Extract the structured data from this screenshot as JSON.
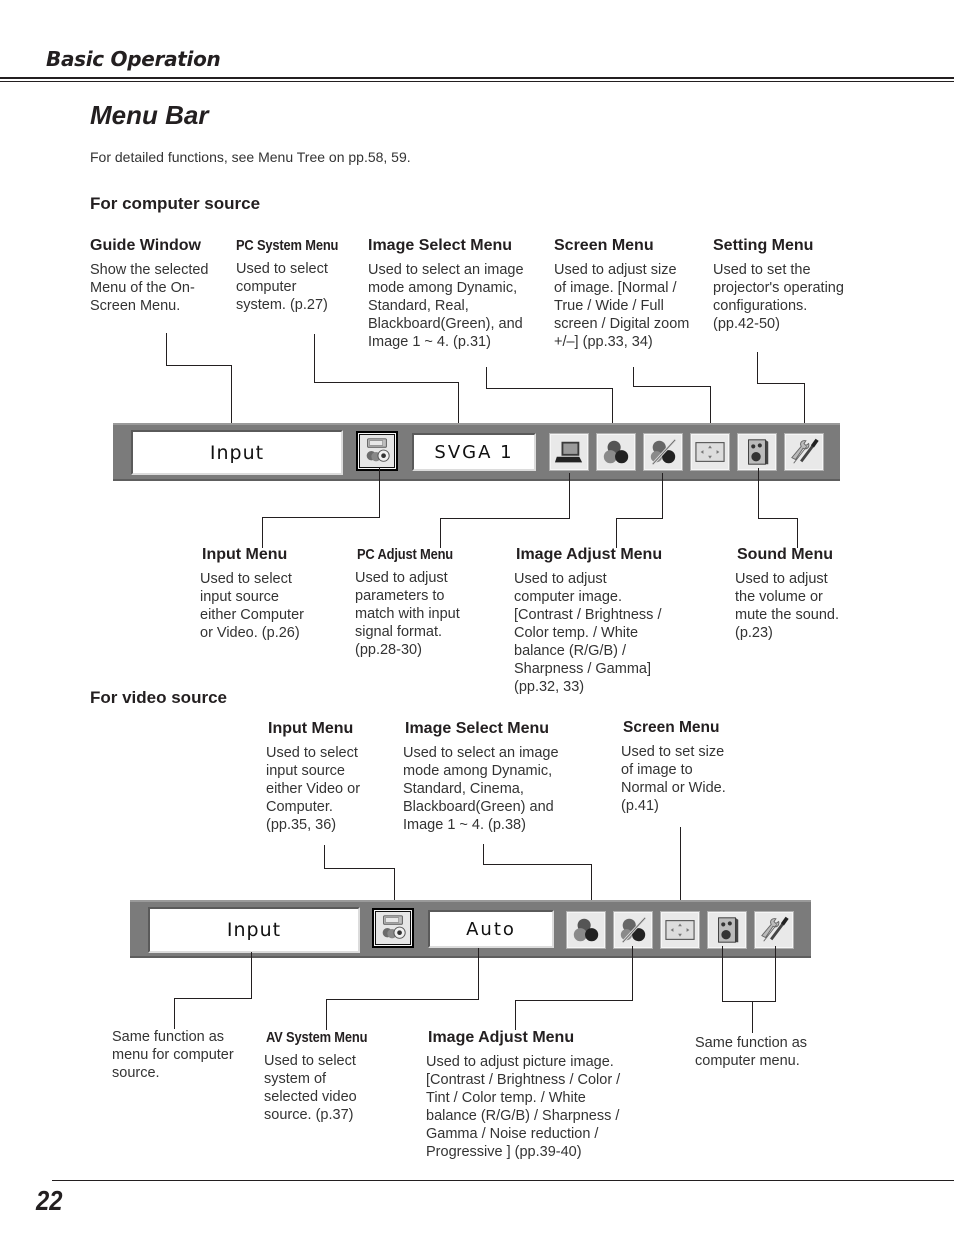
{
  "header": {
    "section": "Basic Operation"
  },
  "page": {
    "title": "Menu Bar",
    "intro": "For detailed functions, see Menu Tree on pp.58, 59.",
    "number": "22"
  },
  "computer_source": {
    "heading": "For computer source",
    "bar": {
      "guide_window_text": "Input",
      "system_text": "SVGA 1",
      "icons": [
        "input-menu-icon",
        "laptop-icon",
        "image-select-icon",
        "image-adjust-icon",
        "screen-icon",
        "sound-icon",
        "setting-icon"
      ]
    },
    "top_labels": [
      {
        "title": "Guide Window",
        "body": "Show the selected\nMenu of the On-\nScreen Menu."
      },
      {
        "title": "PC System Menu",
        "body": "Used to select\ncomputer\nsystem.  (p.27)"
      },
      {
        "title": "Image Select Menu",
        "body": "Used to select an image\nmode among Dynamic,\nStandard, Real,\nBlackboard(Green), and\nImage 1 ~ 4.  (p.31)"
      },
      {
        "title": "Screen Menu",
        "body": "Used to adjust size\nof image.  [Normal /\nTrue / Wide / Full\nscreen / Digital zoom\n+/–]  (pp.33, 34)"
      },
      {
        "title": "Setting Menu",
        "body": "Used to set the\nprojector's operating\nconfigurations.\n (pp.42-50)"
      }
    ],
    "bottom_labels": [
      {
        "title": "Input Menu",
        "body": "Used to select\ninput source\neither Computer\nor Video.  (p.26)"
      },
      {
        "title": "PC Adjust Menu",
        "body": "Used to adjust\nparameters to\nmatch with input\nsignal format.\n(pp.28-30)"
      },
      {
        "title": "Image Adjust Menu",
        "body": "Used to adjust\ncomputer image.\n[Contrast / Brightness /\nColor temp. / White\nbalance (R/G/B) /\nSharpness / Gamma]\n(pp.32, 33)"
      },
      {
        "title": "Sound Menu",
        "body": "Used to adjust\nthe volume or\nmute the sound.\n(p.23)"
      }
    ]
  },
  "video_source": {
    "heading": "For video source",
    "bar": {
      "guide_window_text": "Input",
      "system_text": "Auto",
      "icons": [
        "input-menu-icon",
        "image-select-icon",
        "image-adjust-icon",
        "screen-icon",
        "sound-icon",
        "setting-icon"
      ]
    },
    "top_labels": [
      {
        "title": "Input Menu",
        "body": "Used to select\ninput source\neither Video or\nComputer.\n(pp.35, 36)"
      },
      {
        "title": "Image Select Menu",
        "body": "Used to select an image\nmode among Dynamic,\nStandard, Cinema,\nBlackboard(Green) and\nImage 1 ~ 4.  (p.38)"
      },
      {
        "title": "Screen Menu",
        "body": "Used to set size\nof image to\nNormal or Wide.\n(p.41)"
      }
    ],
    "bottom_labels": [
      {
        "title": "",
        "body": "Same function as\nmenu for computer\nsource."
      },
      {
        "title": "AV System Menu",
        "body": "Used to select\nsystem of\nselected video\nsource.  (p.37)"
      },
      {
        "title": "Image Adjust Menu",
        "body": "Used to adjust picture image.\n[Contrast / Brightness / Color /\nTint / Color temp. / White\nbalance (R/G/B) / Sharpness /\nGamma / Noise reduction /\nProgressive ]  (pp.39-40)"
      },
      {
        "title": "",
        "body": "Same function as\ncomputer menu."
      }
    ]
  }
}
